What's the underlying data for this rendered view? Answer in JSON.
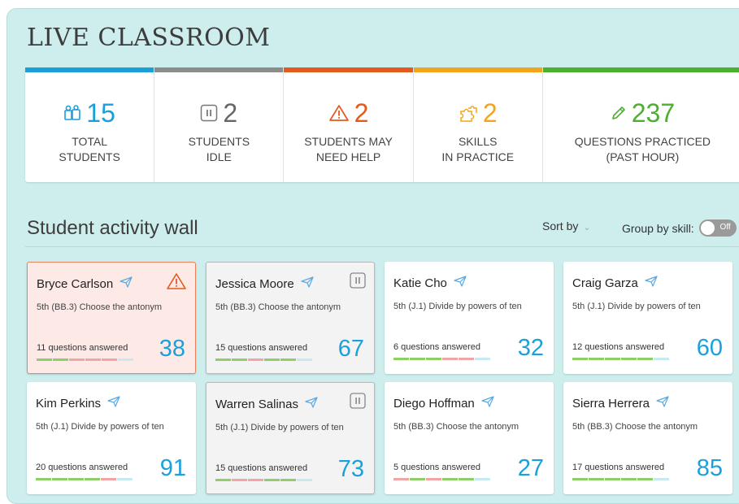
{
  "header": {
    "title": "LIVE CLASSROOM"
  },
  "stats": [
    {
      "value": "15",
      "label": "TOTAL\nSTUDENTS",
      "color": "#1a9fdb",
      "bar": "#1a9fdb",
      "icon": "students-icon"
    },
    {
      "value": "2",
      "label": "STUDENTS\nIDLE",
      "color": "#666666",
      "bar": "#8c8c8c",
      "icon": "pause-icon"
    },
    {
      "value": "2",
      "label": "STUDENTS MAY\nNEED HELP",
      "color": "#e35a1b",
      "bar": "#e35a1b",
      "icon": "warning-icon"
    },
    {
      "value": "2",
      "label": "SKILLS\nIN PRACTICE",
      "color": "#f2a51c",
      "bar": "#f2a51c",
      "icon": "puzzle-icon"
    },
    {
      "value": "237",
      "label": "QUESTIONS PRACTICED\n(PAST HOUR)",
      "color": "#4caf2f",
      "bar": "#4caf2f",
      "icon": "pencil-icon"
    }
  ],
  "wall": {
    "title": "Student activity wall",
    "sort_label": "Sort by",
    "group_label": "Group by skill:",
    "group_toggle": "Off"
  },
  "students": [
    {
      "name": "Bryce Carlson",
      "skill": "5th (BB.3)  Choose the antonym",
      "answered": "11 questions answered",
      "score": "38",
      "state": "alert"
    },
    {
      "name": "Jessica Moore",
      "skill": "5th (BB.3)  Choose the antonym",
      "answered": "15 questions answered",
      "score": "67",
      "state": "idle"
    },
    {
      "name": "Katie Cho",
      "skill": "5th (J.1)  Divide by powers of ten",
      "answered": "6 questions answered",
      "score": "32",
      "state": "normal"
    },
    {
      "name": "Craig Garza",
      "skill": "5th (J.1)  Divide by powers of ten",
      "answered": "12 questions answered",
      "score": "60",
      "state": "normal"
    },
    {
      "name": "Kim Perkins",
      "skill": "5th (J.1)  Divide by powers of ten",
      "answered": "20 questions answered",
      "score": "91",
      "state": "normal"
    },
    {
      "name": "Warren Salinas",
      "skill": "5th (J.1)  Divide by powers of ten",
      "answered": "15 questions answered",
      "score": "73",
      "state": "idle"
    },
    {
      "name": "Diego Hoffman",
      "skill": "5th (BB.3)  Choose the antonym",
      "answered": "5 questions answered",
      "score": "27",
      "state": "normal"
    },
    {
      "name": "Sierra Herrera",
      "skill": "5th (BB.3)  Choose the antonym",
      "answered": "17 questions answered",
      "score": "85",
      "state": "normal"
    }
  ],
  "colors": {
    "correct": "#8fcf6a",
    "incorrect": "#f0a6a6",
    "pending": "#c7e9ef",
    "accent": "#1aa1db"
  }
}
